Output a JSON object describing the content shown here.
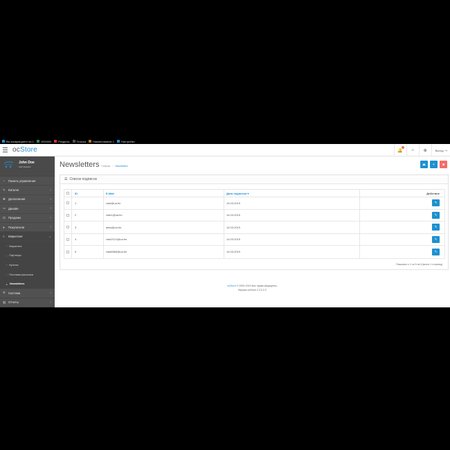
{
  "bookmarks": [
    {
      "label": "Вы возвращаете на 1",
      "color": "#1e91cf"
    },
    {
      "label": "1000000",
      "color": "#2e8b57"
    },
    {
      "label": "Разделы",
      "color": "#d33"
    },
    {
      "label": "Поиска",
      "color": "#555"
    },
    {
      "label": "Наименование 1",
      "color": "#b7791f"
    },
    {
      "label": "Настройки",
      "color": "#1e91cf"
    }
  ],
  "header": {
    "logo_prefix": "oc",
    "logo_main": "Store",
    "logout_label": "Выход"
  },
  "sidebar": {
    "user_name": "John Doe",
    "user_role": "Administrator",
    "items": [
      {
        "label": "Панель управления",
        "icon": "dashboard-icon",
        "glyph": "◔"
      },
      {
        "label": "Каталог",
        "icon": "tag-icon",
        "glyph": "✎"
      },
      {
        "label": "Дополнения",
        "icon": "puzzle-icon",
        "glyph": "✚"
      },
      {
        "label": "Дизайн",
        "icon": "tv-icon",
        "glyph": "▭"
      },
      {
        "label": "Продажи",
        "icon": "cart-icon",
        "glyph": "⊡"
      },
      {
        "label": "Покупатели",
        "icon": "user-icon",
        "glyph": "●"
      },
      {
        "label": "Маркетинг",
        "icon": "share-icon",
        "glyph": "<"
      }
    ],
    "sub_items": [
      {
        "label": "Маркетинг"
      },
      {
        "label": "Партнеры"
      },
      {
        "label": "Купоны"
      },
      {
        "label": "Почтовая рассылка"
      },
      {
        "label": "Newsletters"
      }
    ],
    "bottom_items": [
      {
        "label": "Система",
        "icon": "gear-icon",
        "glyph": "✲"
      },
      {
        "label": "Отчеты",
        "icon": "bar-chart-icon",
        "glyph": "▥"
      }
    ]
  },
  "page": {
    "title": "Newsletters",
    "breadcrumb": [
      "Главная",
      "Newsletters"
    ]
  },
  "panel": {
    "title": "Список подписок",
    "columns": {
      "id": "ID",
      "email": "E-Mail",
      "date": "Дата подписки ▾",
      "actions": "Действие"
    },
    "rows": [
      {
        "id": "1",
        "email": "vlad@ua.fm",
        "date": "14.03.2019"
      },
      {
        "id": "2",
        "email": "vlad1@ua.fm",
        "date": "14.03.2019"
      },
      {
        "id": "3",
        "email": "asss@ua.fm",
        "date": "14.03.2019"
      },
      {
        "id": "4",
        "email": "vlad2121@ua.fm",
        "date": "14.03.2019"
      },
      {
        "id": "5",
        "email": "vlad6565@ua.fm",
        "date": "14.03.2019"
      }
    ],
    "pagination_text": "Показано с 1 по 5 из 5 (всего 1 страниц)"
  },
  "footer": {
    "brand": "ocStore",
    "line1": " © 2009-2019 Все права защищены.",
    "line2": "Версия ocStore 2.3.0.2.3"
  },
  "colors": {
    "accent": "#1e91cf",
    "danger": "#f56b6b",
    "sidebar": "#515151"
  }
}
